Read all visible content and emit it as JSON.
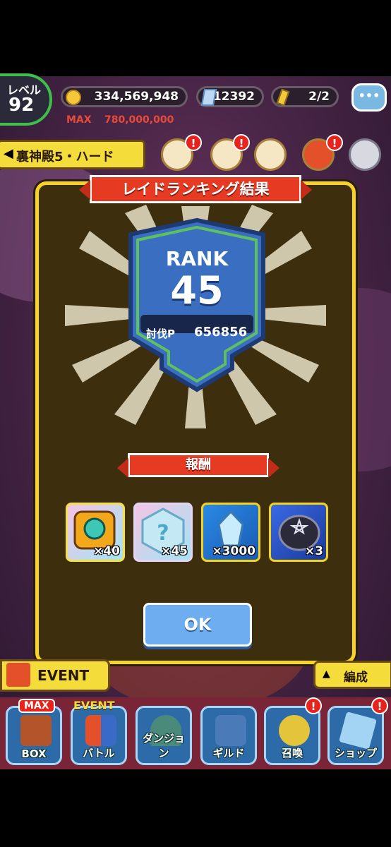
{
  "hud": {
    "level_label": "レベル",
    "level_value": "92",
    "coins": "334,569,948",
    "coins_max_label": "MAX",
    "coins_max": "780,000,000",
    "crystals": "12392",
    "stamina": "2/2",
    "stage_name": "裏神殿5・ハード"
  },
  "modal": {
    "title": "レイドランキング結果",
    "rank_label": "RANK",
    "rank_value": "45",
    "points_label": "討伐P",
    "points_value": "656856",
    "rewards_title": "報酬",
    "rewards": [
      {
        "name": "gold-key-icon",
        "qty": "×40"
      },
      {
        "name": "mystery-crystal-icon",
        "qty": "×45"
      },
      {
        "name": "blue-crystal-icon",
        "qty": "×3000"
      },
      {
        "name": "pentagram-stone-icon",
        "qty": "×3"
      }
    ],
    "ok_label": "OK"
  },
  "side": {
    "event_label": "EVENT",
    "formation_label": "編成"
  },
  "nav": [
    {
      "label": "BOX",
      "badge": "MAX"
    },
    {
      "label": "バトル",
      "badge": "EVENT"
    },
    {
      "label": "ダンジョン"
    },
    {
      "label": "ギルド"
    },
    {
      "label": "召喚",
      "alert": "!"
    },
    {
      "label": "ショップ",
      "alert": "!"
    }
  ]
}
